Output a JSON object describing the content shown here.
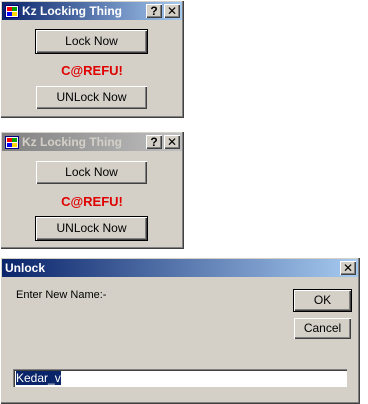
{
  "window1": {
    "title": "Kz Locking Thing",
    "help_label": "?",
    "close_label": "✕",
    "lock_label": "Lock Now",
    "warning": "C@REFU!",
    "unlock_label": "UNLock Now"
  },
  "window2": {
    "title": "Kz Locking Thing",
    "help_label": "?",
    "close_label": "✕",
    "lock_label": "Lock Now",
    "warning": "C@REFU!",
    "unlock_label": "UNLock Now"
  },
  "dialog": {
    "title": "Unlock",
    "close_label": "✕",
    "prompt": "Enter New Name:-",
    "ok_label": "OK",
    "cancel_label": "Cancel",
    "input_value": "Kedar_v"
  },
  "colors": {
    "window_bg": "#d4d0c8",
    "title_active": "#0a246a",
    "warning": "#e00000"
  }
}
